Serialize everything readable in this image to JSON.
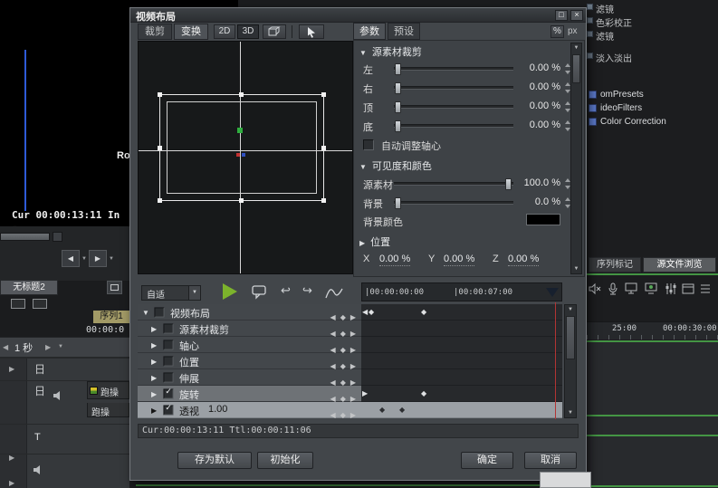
{
  "icons": {
    "expand_down": "▼",
    "expand_right": "▶",
    "keyframe": "◆",
    "key_prev": "◀",
    "key_next": "▶",
    "nav_diamond": "◆",
    "maximize": "□",
    "close": "×",
    "check": "✓",
    "dropdown": "▼",
    "undo": "↩",
    "redo": "↪",
    "step_left": "◀",
    "step_right": "▶"
  },
  "dialog": {
    "title": "视频布局",
    "left_tabs": {
      "crop": "裁剪",
      "transform": "变换"
    },
    "toolbar": {
      "mode_2d": "2D",
      "mode_3d": "3D"
    },
    "right_tabs": {
      "params": "参数",
      "presets": "预设"
    },
    "units": {
      "percent": "%",
      "pixels": "px"
    },
    "crop": {
      "header": "源素材裁剪",
      "rows": [
        {
          "label": "左",
          "value": "0.00 %"
        },
        {
          "label": "右",
          "value": "0.00 %"
        },
        {
          "label": "顶",
          "value": "0.00 %"
        },
        {
          "label": "底",
          "value": "0.00 %"
        }
      ],
      "auto_axis": "自动调整轴心"
    },
    "visibility": {
      "header": "可见度和颜色",
      "rows": [
        {
          "label": "源素材",
          "value": "100.0 %"
        },
        {
          "label": "背景",
          "value": "0.0 %"
        }
      ],
      "bg_color_label": "背景颜色",
      "bg_color": "#000000"
    },
    "position": {
      "header": "位置",
      "axes": [
        {
          "label": "X",
          "value": "0.00 %"
        },
        {
          "label": "Y",
          "value": "0.00 %"
        },
        {
          "label": "Z",
          "value": "0.00 %"
        }
      ]
    },
    "timeline": {
      "zoom": "自适",
      "tick_start": "|00:00:00:00",
      "tick_mid": "|00:00:07:00",
      "rows": [
        {
          "expander": "▼",
          "label": "视频布局",
          "value": ""
        },
        {
          "expander": "▶",
          "label": "源素材裁剪",
          "value": ""
        },
        {
          "expander": "▶",
          "label": "轴心",
          "value": ""
        },
        {
          "expander": "▶",
          "label": "位置",
          "value": ""
        },
        {
          "expander": "▶",
          "label": "伸展",
          "value": ""
        },
        {
          "expander": "▶",
          "label": "旋转",
          "value": ""
        },
        {
          "expander": "▶",
          "label": "透视",
          "value": "1.00"
        }
      ],
      "status": "Cur:00:00:13:11 Ttl:00:00:11:06"
    },
    "footer": {
      "save_default": "存为默认",
      "init": "初始化",
      "ok": "确定",
      "cancel": "取消"
    }
  },
  "app": {
    "monitor": {
      "ro": "Ro",
      "status": "Cur 00:00:13:11  In -"
    },
    "effects": [
      "滤镜",
      "色彩校正",
      "滤镜",
      "淡入淡出"
    ],
    "tree": [
      "omPresets",
      "ideoFilters",
      "Color Correction"
    ],
    "panel_tabs": {
      "seq_marker": "序列标记",
      "source_browser": "源文件浏览"
    },
    "ruler": {
      "t1": "25:00",
      "t2": "00:00:30:00"
    },
    "sequence_tab": "无标题2",
    "seq_label": "序列1",
    "timecode_partial": "00:00:0",
    "track_scale": "1 秒",
    "track_t": "T",
    "track_v1": "日",
    "track_v2": "日",
    "clip1": "跑操",
    "clip2": "跑操"
  }
}
